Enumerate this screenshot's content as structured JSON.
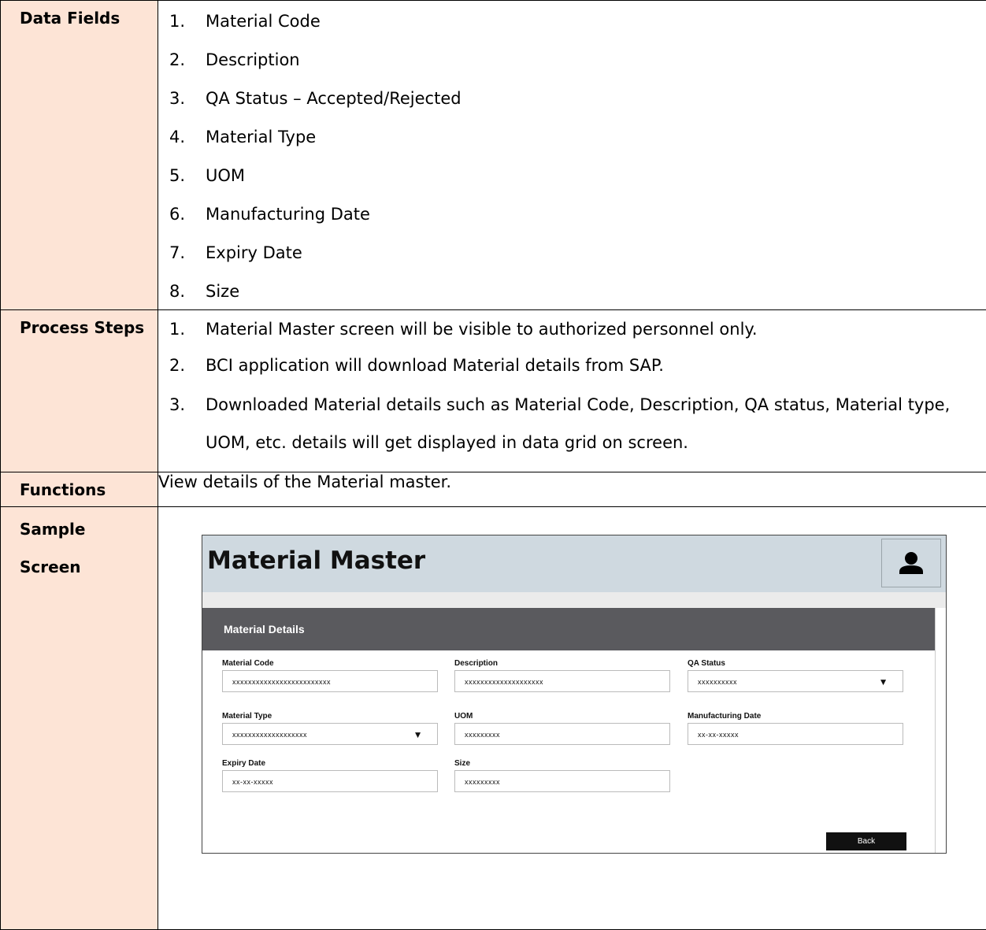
{
  "data_fields": {
    "label": "Data Fields",
    "items": [
      {
        "num": "1.",
        "text": "Material Code"
      },
      {
        "num": "2.",
        "text": "Description"
      },
      {
        "num": "3.",
        "text": "QA Status – Accepted/Rejected"
      },
      {
        "num": "4.",
        "text": "Material Type"
      },
      {
        "num": "5.",
        "text": "UOM"
      },
      {
        "num": "6.",
        "text": "Manufacturing Date"
      },
      {
        "num": "7.",
        "text": "Expiry Date"
      },
      {
        "num": "8.",
        "text": "Size"
      }
    ]
  },
  "process_steps": {
    "label": "Process Steps",
    "items": [
      {
        "num": "1.",
        "text": "Material Master screen will be visible to authorized personnel only."
      },
      {
        "num": "2.",
        "text": "BCI application will download Material details from SAP."
      },
      {
        "num": "3.",
        "text": "Downloaded Material details such as Material Code, Description, QA status, Material type, UOM, etc. details will get displayed in data grid on screen."
      }
    ]
  },
  "functions": {
    "label": "Functions",
    "text": "View details of the Material master."
  },
  "sample_screen": {
    "label_line1": "Sample",
    "label_line2": "Screen",
    "title": "Material Master",
    "user_icon": "user-icon",
    "panel_title": "Material Details",
    "fields": {
      "material_code": {
        "label": "Material Code",
        "value": "xxxxxxxxxxxxxxxxxxxxxxxxx"
      },
      "description": {
        "label": "Description",
        "value": "xxxxxxxxxxxxxxxxxxxx"
      },
      "qa_status": {
        "label": "QA Status",
        "value": "xxxxxxxxxx"
      },
      "material_type": {
        "label": "Material Type",
        "value": "xxxxxxxxxxxxxxxxxxx"
      },
      "uom": {
        "label": "UOM",
        "value": "xxxxxxxxx"
      },
      "manufacturing_date": {
        "label": "Manufacturing Date",
        "value": "xx-xx-xxxxx"
      },
      "expiry_date": {
        "label": "Expiry Date",
        "value": "xx-xx-xxxxx"
      },
      "size": {
        "label": "Size",
        "value": "xxxxxxxxx"
      }
    },
    "back_label": "Back"
  }
}
